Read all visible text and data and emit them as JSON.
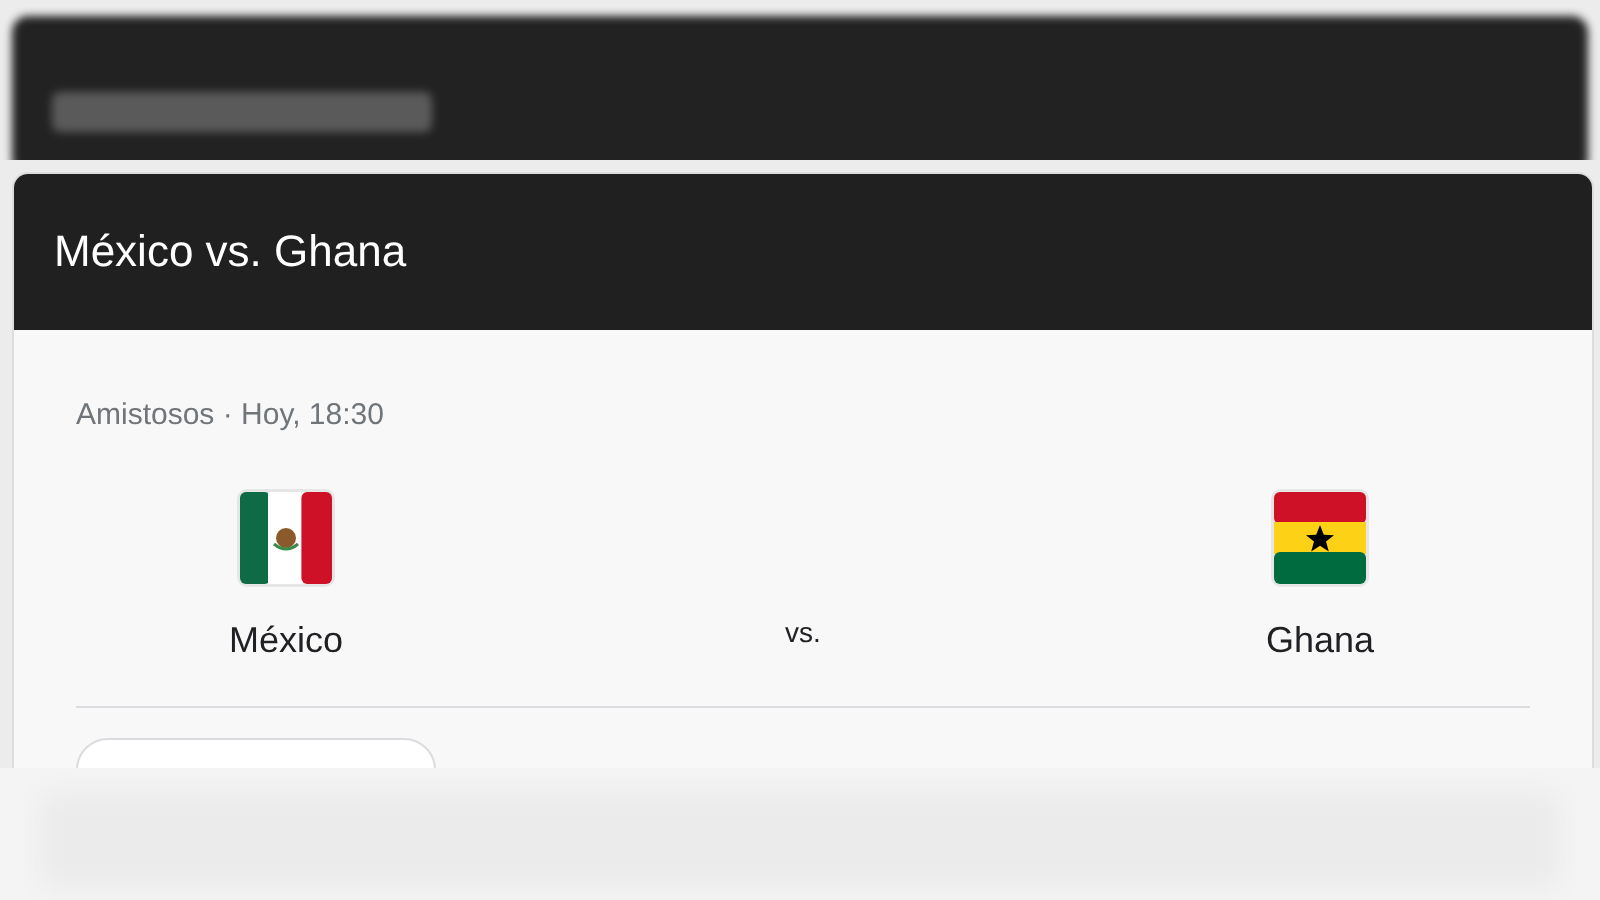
{
  "card": {
    "title": "México vs. Ghana",
    "meta": "Amistosos · Hoy, 18:30",
    "separator": "vs.",
    "teams": [
      {
        "name": "México"
      },
      {
        "name": "Ghana"
      }
    ]
  }
}
